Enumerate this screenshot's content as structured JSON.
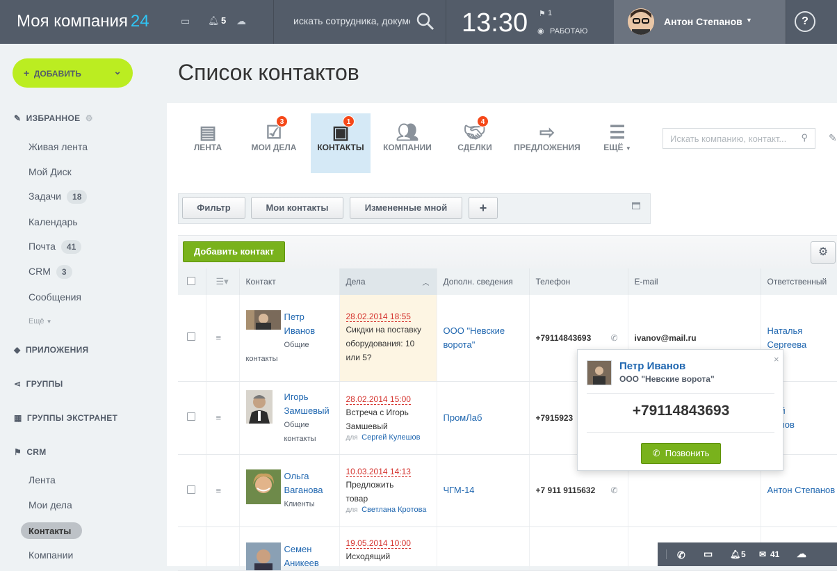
{
  "topbar": {
    "company": "Моя компания",
    "company_suffix": "24",
    "notifications_count": "5",
    "search_placeholder": "искать сотрудника, документ...",
    "time": "13:30",
    "flag_count": "1",
    "work_status": "РАБОТАЮ",
    "user_name": "Антон Степанов",
    "help": "?"
  },
  "sidebar": {
    "add_button": "ДОБАВИТЬ",
    "favorites": "ИЗБРАННОЕ",
    "items": [
      {
        "label": "Живая лента"
      },
      {
        "label": "Мой Диск"
      },
      {
        "label": "Задачи",
        "count": "18"
      },
      {
        "label": "Календарь"
      },
      {
        "label": "Почта",
        "count": "41"
      },
      {
        "label": "CRM",
        "count": "3"
      },
      {
        "label": "Сообщения"
      }
    ],
    "more": "Ещё",
    "apps": "ПРИЛОЖЕНИЯ",
    "groups": "ГРУППЫ",
    "extranet": "ГРУППЫ ЭКСТРАНЕТ",
    "crm": "CRM",
    "crm_items": [
      {
        "label": "Лента"
      },
      {
        "label": "Мои дела"
      },
      {
        "label": "Контакты"
      },
      {
        "label": "Компании"
      }
    ]
  },
  "page": {
    "title": "Список контактов"
  },
  "tabs": [
    {
      "label": "ЛЕНТА",
      "badge": ""
    },
    {
      "label": "МОИ ДЕЛА",
      "badge": "3"
    },
    {
      "label": "КОНТАКТЫ",
      "badge": "1"
    },
    {
      "label": "КОМПАНИИ",
      "badge": ""
    },
    {
      "label": "СДЕЛКИ",
      "badge": "4"
    },
    {
      "label": "ПРЕДЛОЖЕНИЯ",
      "badge": ""
    },
    {
      "label": "ЕЩЁ",
      "badge": ""
    }
  ],
  "right_search_placeholder": "Искать компанию, контакт...",
  "filters": {
    "filter": "Фильтр",
    "my_contacts": "Мои контакты",
    "changed_by_me": "Измененные мной",
    "add": "+"
  },
  "actions": {
    "add_contact": "Добавить контакт"
  },
  "table": {
    "columns": [
      "Контакт",
      "Дела",
      "Дополн. сведения",
      "Телефон",
      "E-mail",
      "Ответственный"
    ],
    "rows": [
      {
        "first": "Петр",
        "last": "Иванов",
        "type1": "Общие",
        "type2": "контакты",
        "deal_date": "28.02.2014 18:55",
        "deal_text": "Сикдки на поставку оборудования: 10 или 5?",
        "deal_for": "",
        "deal_for_name": "",
        "extra": "ООО \"Невские ворота\"",
        "phone": "+79114843693",
        "email": "ivanov@mail.ru",
        "resp1": "Наталья",
        "resp2": "Сергеева"
      },
      {
        "first": "Игорь",
        "last": "Замшевый",
        "type1": "Общие",
        "type2": "контакты",
        "deal_date": "28.02.2014 15:00",
        "deal_text": "Встреча с Игорь Замшевый",
        "deal_for": "для",
        "deal_for_name": "Сергей Кулешов",
        "extra": "ПромЛаб",
        "phone": "+7915923",
        "email": "",
        "resp1": "ргей",
        "resp2": "лешов"
      },
      {
        "first": "Ольга",
        "last": "Ваганова",
        "type1": "Клиенты",
        "type2": "",
        "deal_date": "10.03.2014 14:13",
        "deal_text": "Предложить товар",
        "deal_for": "для",
        "deal_for_name": "Светлана Кротова",
        "extra": "ЧГМ-14",
        "phone": "+7 911 9115632",
        "email": "",
        "resp1": "Антон Степанов",
        "resp2": ""
      },
      {
        "first": "Семен",
        "last": "Аникеев",
        "type1": "",
        "type2": "",
        "deal_date": "19.05.2014 10:00",
        "deal_text": "Исходящий",
        "deal_for": "",
        "deal_for_name": "",
        "extra": "",
        "phone": "",
        "email": "",
        "resp1": "",
        "resp2": ""
      }
    ]
  },
  "popup": {
    "name": "Петр Иванов",
    "company": "ООО \"Невские ворота\"",
    "phone": "+79114843693",
    "call": "Позвонить"
  },
  "bottombar": {
    "notifications": "5",
    "mail": "41"
  },
  "colors": {
    "topbar": "#535c69",
    "accent_green": "#bbed21",
    "link": "#2067b0",
    "badge": "#f54819",
    "button_green": "#79b21c"
  }
}
